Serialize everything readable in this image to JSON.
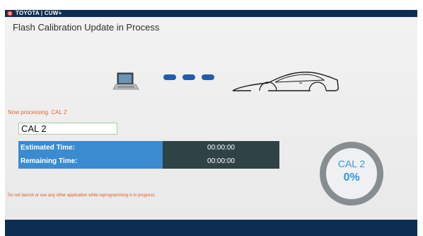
{
  "app": {
    "title": "TOYOTA | CUW+"
  },
  "window": {
    "title": "Flash Calibration Update in Process"
  },
  "status": {
    "processing_text": "Now processing. CAL 2",
    "cal_field_value": "CAL 2",
    "warning": "Do not launch or use any other application while reprogramming is in progress."
  },
  "times": [
    {
      "label": "Estimated Time:",
      "value": "00:00:00"
    },
    {
      "label": "Remaining Time:",
      "value": "00:00:00"
    }
  ],
  "progress": {
    "cal_label": "CAL 2",
    "percent_text": "0%",
    "percent": 0
  },
  "colors": {
    "topbar": "#0c2e52",
    "label_bg": "#3a8bd0",
    "value_bg": "#2f4346",
    "accent": "#2d9bd8",
    "warning": "#e0562b",
    "dots": "#1f5eae"
  },
  "icons": [
    "toyota-logo-icon",
    "laptop-icon",
    "connection-dots-icon",
    "car-icon"
  ]
}
